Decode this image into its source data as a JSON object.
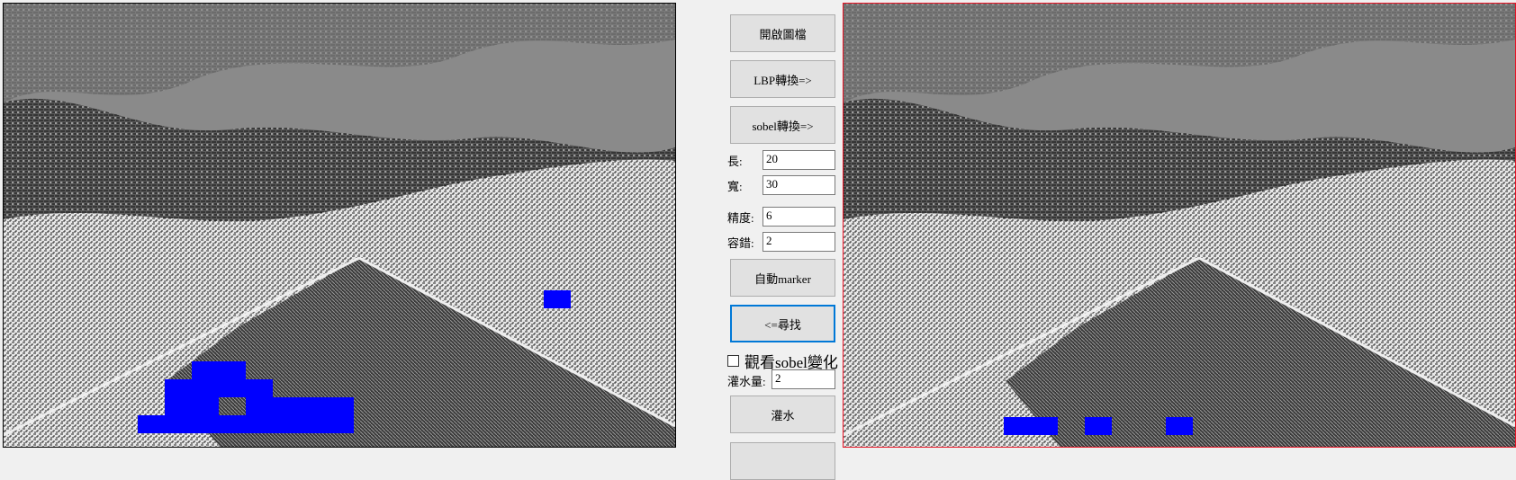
{
  "buttons": {
    "open_image": "開啟圖檔",
    "lbp_convert": "LBP轉換=>",
    "sobel_convert": "sobel轉換=>",
    "auto_marker": "自動marker",
    "search": "<=尋找",
    "flood": "灌水"
  },
  "fields": {
    "length": {
      "label": "長:",
      "value": "20"
    },
    "width": {
      "label": "寬:",
      "value": "30"
    },
    "precision": {
      "label": "精度:",
      "value": "6"
    },
    "tolerance": {
      "label": "容錯:",
      "value": "2"
    },
    "flood_amount": {
      "label": "灌水量:",
      "value": "2"
    }
  },
  "checkbox": {
    "label": "觀看sobel變化",
    "checked": false
  },
  "colors": {
    "marker": "#0000ff",
    "selected_border": "#e81123",
    "focus_border": "#0078d7"
  }
}
